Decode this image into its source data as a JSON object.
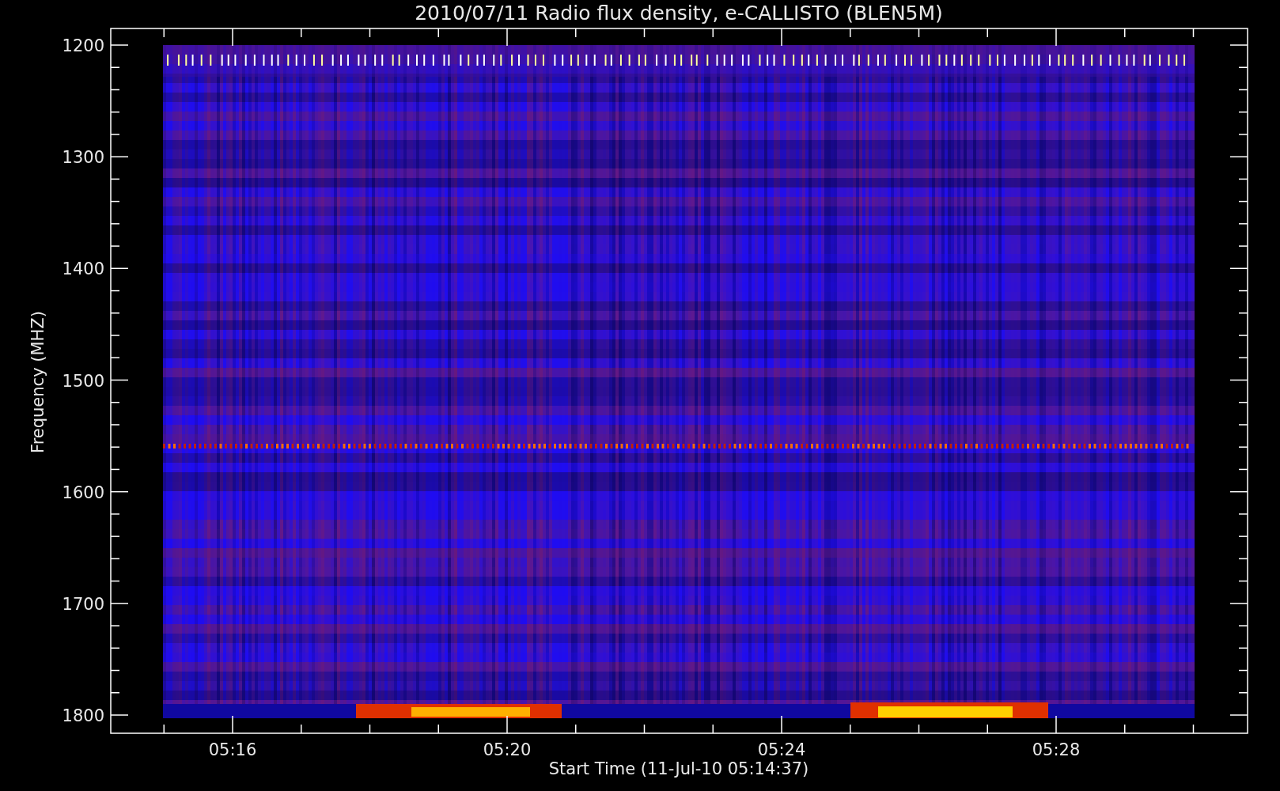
{
  "title": "2010/07/11  Radio flux density, e-CALLISTO (BLEN5M)",
  "y_axis": {
    "label": "Frequency (MHZ)",
    "ticks": [
      "1200",
      "1300",
      "1400",
      "1500",
      "1600",
      "1700",
      "1800"
    ]
  },
  "x_axis": {
    "label": "Start Time (11-Jul-10 05:14:37)",
    "ticks": [
      "05:16",
      "05:20",
      "05:24",
      "05:28"
    ]
  }
}
